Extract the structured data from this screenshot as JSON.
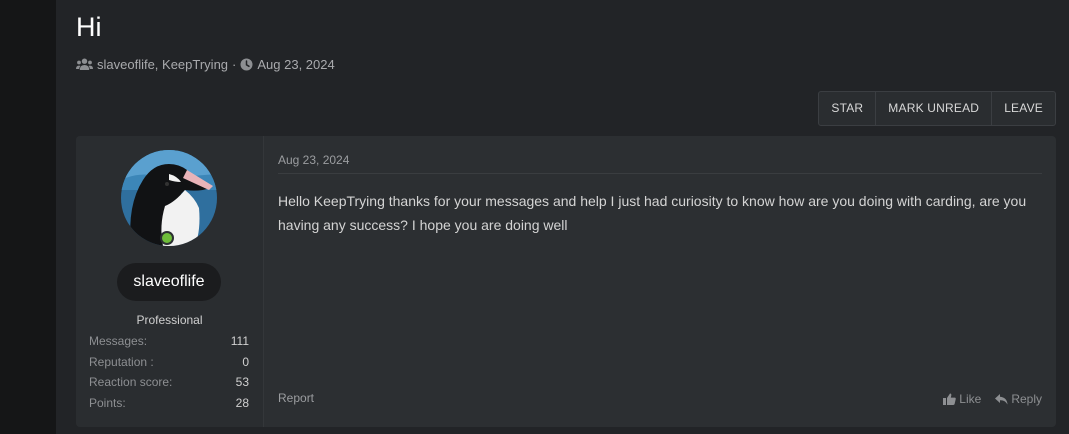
{
  "thread": {
    "title": "Hi",
    "participants": "slaveoflife, KeepTrying",
    "separator": "·",
    "date": "Aug 23, 2024"
  },
  "toolbar": {
    "star_label": "STAR",
    "mark_unread_label": "MARK UNREAD",
    "leave_label": "LEAVE"
  },
  "message": {
    "author": {
      "username": "slaveoflife",
      "title": "Professional",
      "stats": [
        {
          "label": "Messages:",
          "value": "111"
        },
        {
          "label": "Reputation :",
          "value": "0"
        },
        {
          "label": "Reaction score:",
          "value": "53"
        },
        {
          "label": "Points:",
          "value": "28"
        }
      ]
    },
    "date": "Aug 23, 2024",
    "body": "Hello KeepTrying thanks for your messages and help I just had curiosity to know how are you doing with carding, are you having any success? I hope you are doing well",
    "report_label": "Report",
    "like_label": "Like",
    "reply_label": "Reply"
  }
}
